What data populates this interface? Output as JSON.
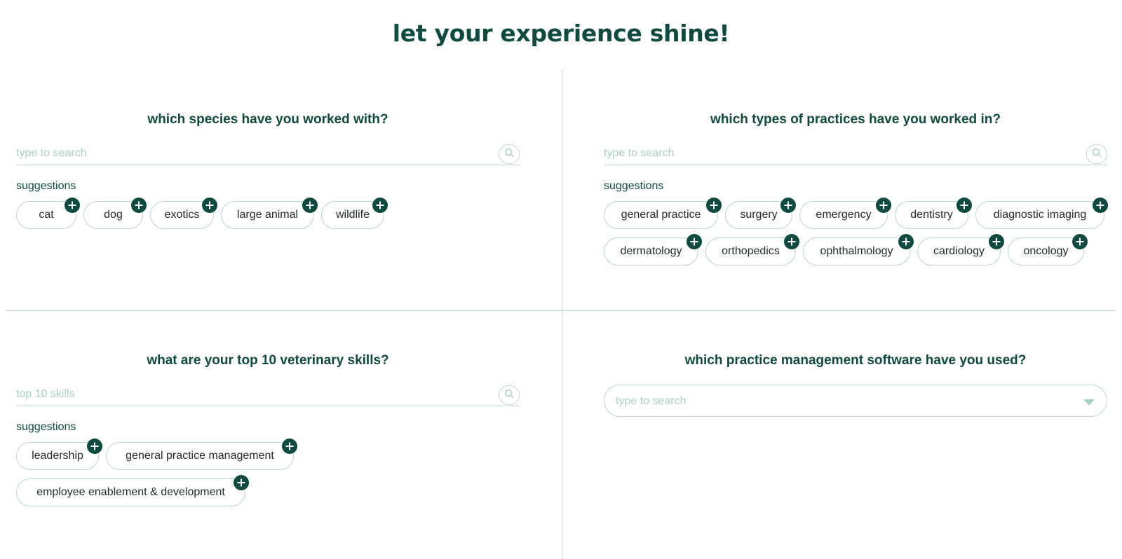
{
  "title": "let your experience shine!",
  "species": {
    "question": "which species have you worked with?",
    "search_placeholder": "type to search",
    "suggestions_label": "suggestions",
    "chips": [
      "cat",
      "dog",
      "exotics",
      "large animal",
      "wildlife"
    ]
  },
  "practices": {
    "question": "which types of practices have you worked in?",
    "search_placeholder": "type to search",
    "suggestions_label": "suggestions",
    "chips": [
      "general practice",
      "surgery",
      "emergency",
      "dentistry",
      "diagnostic imaging",
      "dermatology",
      "orthopedics",
      "ophthalmology",
      "cardiology",
      "oncology"
    ]
  },
  "skills": {
    "question": "what are your top 10 veterinary skills?",
    "search_placeholder": "top 10 skills",
    "suggestions_label": "suggestions",
    "chips": [
      "leadership",
      "general practice management",
      "employee enablement & development"
    ]
  },
  "software": {
    "question": "which practice management software have you used?",
    "dropdown_placeholder": "type to search"
  },
  "colors": {
    "accent": "#0e4a3f",
    "divider": "#bfd8d2",
    "placeholder": "#a9cfc7"
  },
  "icons": {
    "search": "search-icon",
    "add": "plus-icon",
    "caret": "chevron-down-icon"
  }
}
